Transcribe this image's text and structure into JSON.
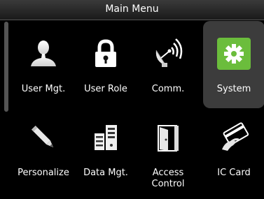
{
  "header": {
    "title": "Main Menu"
  },
  "menu": {
    "items": [
      {
        "label": "User Mgt.",
        "icon": "user-icon"
      },
      {
        "label": "User Role",
        "icon": "lock-icon"
      },
      {
        "label": "Comm.",
        "icon": "satellite-dish-icon"
      },
      {
        "label": "System",
        "icon": "gear-icon",
        "selected": true
      },
      {
        "label": "Personalize",
        "icon": "pencil-icon"
      },
      {
        "label": "Data Mgt.",
        "icon": "data-server-icon"
      },
      {
        "label_line1": "Access",
        "label_line2": "Control",
        "icon": "door-icon"
      },
      {
        "label": "IC Card",
        "icon": "ic-card-icon"
      }
    ]
  },
  "colors": {
    "selected_accent": "#6bbd3c",
    "selected_bg": "#3c3c3c",
    "background": "#000000"
  }
}
